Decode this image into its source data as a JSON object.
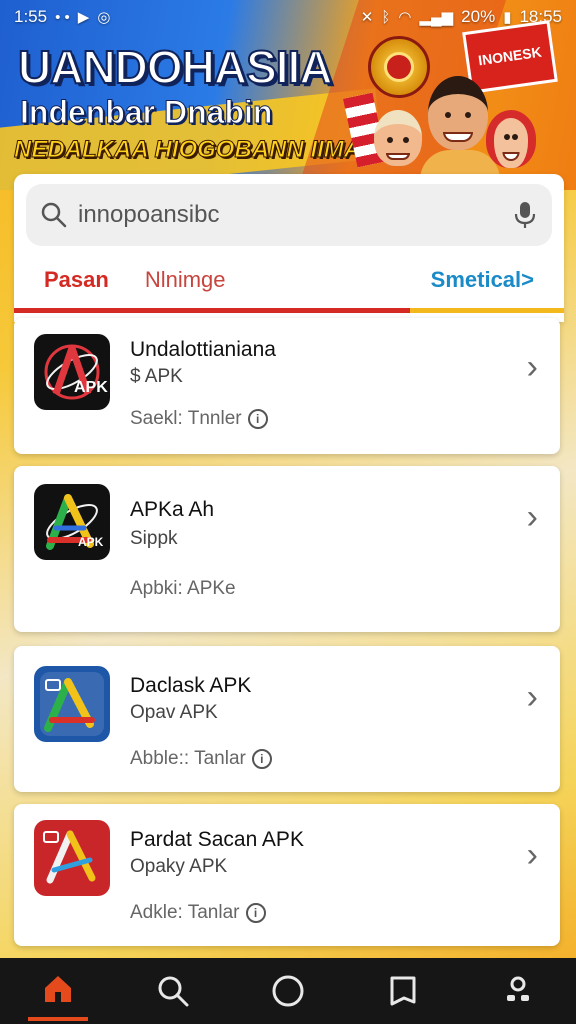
{
  "status_bar": {
    "time": "1:55",
    "battery": "20%",
    "clock_right": "18:55"
  },
  "hero": {
    "title": "UANDOHASIIA",
    "subtitle": "Indenbar Dnabin",
    "tagline": "NEDALKAA HIOGOBANN IIMA",
    "sign_text": "INONESK"
  },
  "search": {
    "placeholder": "innopoansibc"
  },
  "tabs": [
    {
      "label": "Pasan"
    },
    {
      "label": "Nlnimge"
    },
    {
      "label": "Smetical>"
    }
  ],
  "apps": [
    {
      "title": "Undalottianiana",
      "subtitle": "$ APK",
      "meta": "Saekl: Tnnler",
      "has_info": true,
      "icon_text": "APK",
      "icon_bg": "#111111"
    },
    {
      "title": "APKa Ah",
      "subtitle": "Sippk",
      "meta": "Apbki: APKe",
      "has_info": false,
      "icon_text": "APK",
      "icon_bg": "#111111"
    },
    {
      "title": "Daclask APK",
      "subtitle": "Opav APK",
      "meta": "Abble:: Tanlar",
      "has_info": true,
      "icon_text": "",
      "icon_bg": "#1f57a8"
    },
    {
      "title": "Pardat Sacan APK",
      "subtitle": "Opaky APK",
      "meta": "Adkle: Tanlar",
      "has_info": true,
      "icon_text": "",
      "icon_bg": "#c9262a"
    }
  ],
  "colors": {
    "accent_red": "#d52a23",
    "accent_blue": "#1a8bc8",
    "nav_bg": "#161616"
  },
  "bottom_nav": [
    "home-icon",
    "search-icon",
    "circle-icon",
    "bookmark-icon",
    "profile-icon"
  ]
}
